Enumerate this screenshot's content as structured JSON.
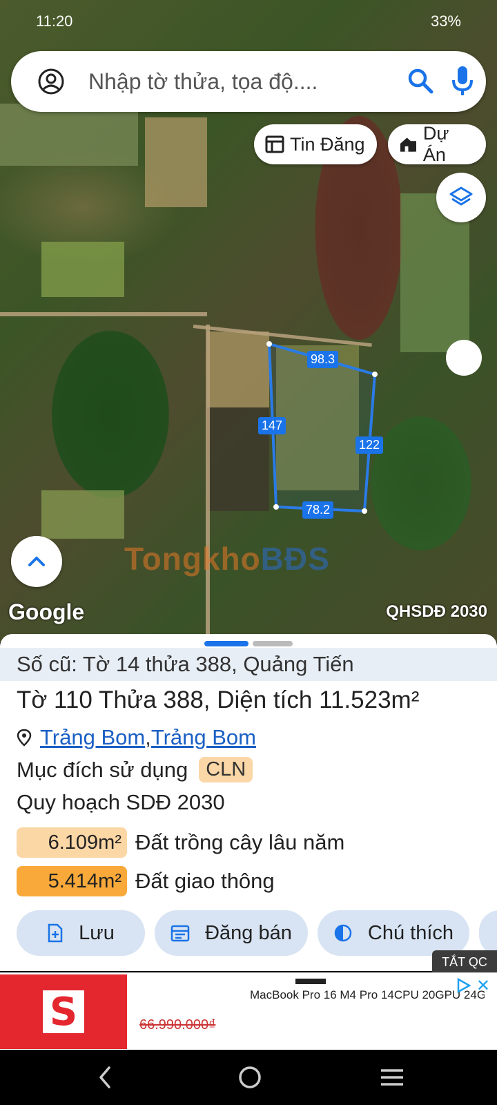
{
  "status_bar": {
    "time": "11:20",
    "battery": "33%"
  },
  "search": {
    "placeholder": "Nhập tờ thửa, tọa độ...."
  },
  "chips": {
    "tin_dang": "Tin Đăng",
    "du_an": "Dự Án"
  },
  "parcel_segments": {
    "top": "98.3",
    "left": "147",
    "right": "122",
    "bottom": "78.2"
  },
  "map": {
    "watermark_a": "Tongkho",
    "watermark_b": "BĐS",
    "google": "Google",
    "layer_label": "QHSDĐ 2030"
  },
  "sheet": {
    "old_info": "Số cũ: Tờ 14 thửa 388, Quảng Tiến",
    "title": "Tờ 110 Thửa 388, Diện tích 11.523m²",
    "location": {
      "district": "Trảng Bom",
      "separator": ", ",
      "province": "Trảng Bom"
    },
    "purpose_label": "Mục đích sử dụng",
    "purpose_code": "CLN",
    "plan": "Quy hoạch SDĐ 2030",
    "land_uses": [
      {
        "area": "6.109m²",
        "label": "Đất trồng cây lâu năm",
        "color": "#fcd7a6"
      },
      {
        "area": "5.414m²",
        "label": "Đất giao thông",
        "color": "#f8a93a"
      }
    ],
    "actions": {
      "save": "Lưu",
      "post_sale": "Đăng bán",
      "legend": "Chú thích"
    }
  },
  "ad_hide": "TẮT QC",
  "ad": {
    "brand_letter": "S",
    "title": "MacBook Pro 16 M4 Pro 14CPU 20GPU 24G...",
    "price": "66.990.000₫",
    "close": "✕"
  },
  "colors": {
    "accent": "#1a73e8",
    "parcel_outline": "#2a7be6",
    "ad_brand": "#e4262f"
  }
}
